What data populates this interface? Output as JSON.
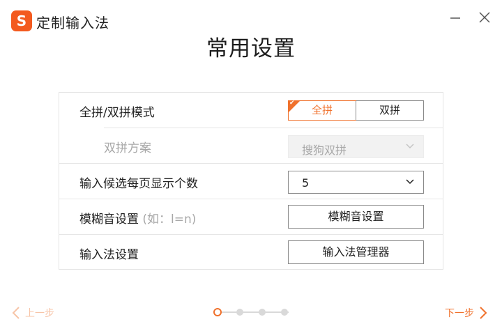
{
  "app": {
    "logo_letter": "S",
    "title": "定制输入法"
  },
  "page": {
    "title": "常用设置"
  },
  "settings": {
    "pinyin_mode": {
      "label": "全拼/双拼模式",
      "options": [
        "全拼",
        "双拼"
      ],
      "selected": "全拼"
    },
    "shuangpin_scheme": {
      "label": "双拼方案",
      "value": "搜狗双拼",
      "disabled": true
    },
    "candidates_per_page": {
      "label": "输入候选每页显示个数",
      "value": "5"
    },
    "fuzzy_sound": {
      "label": "模糊音设置",
      "hint": "(如：l=n)",
      "button_label": "模糊音设置"
    },
    "ime_settings": {
      "label": "输入法设置",
      "button_label": "输入法管理器"
    }
  },
  "footer": {
    "prev_label": "上一步",
    "next_label": "下一步",
    "steps_total": 4,
    "current_step": 1
  },
  "colors": {
    "accent": "#f0712c",
    "logo": "#f35a1f",
    "disabled_text": "#a8a8a8"
  }
}
